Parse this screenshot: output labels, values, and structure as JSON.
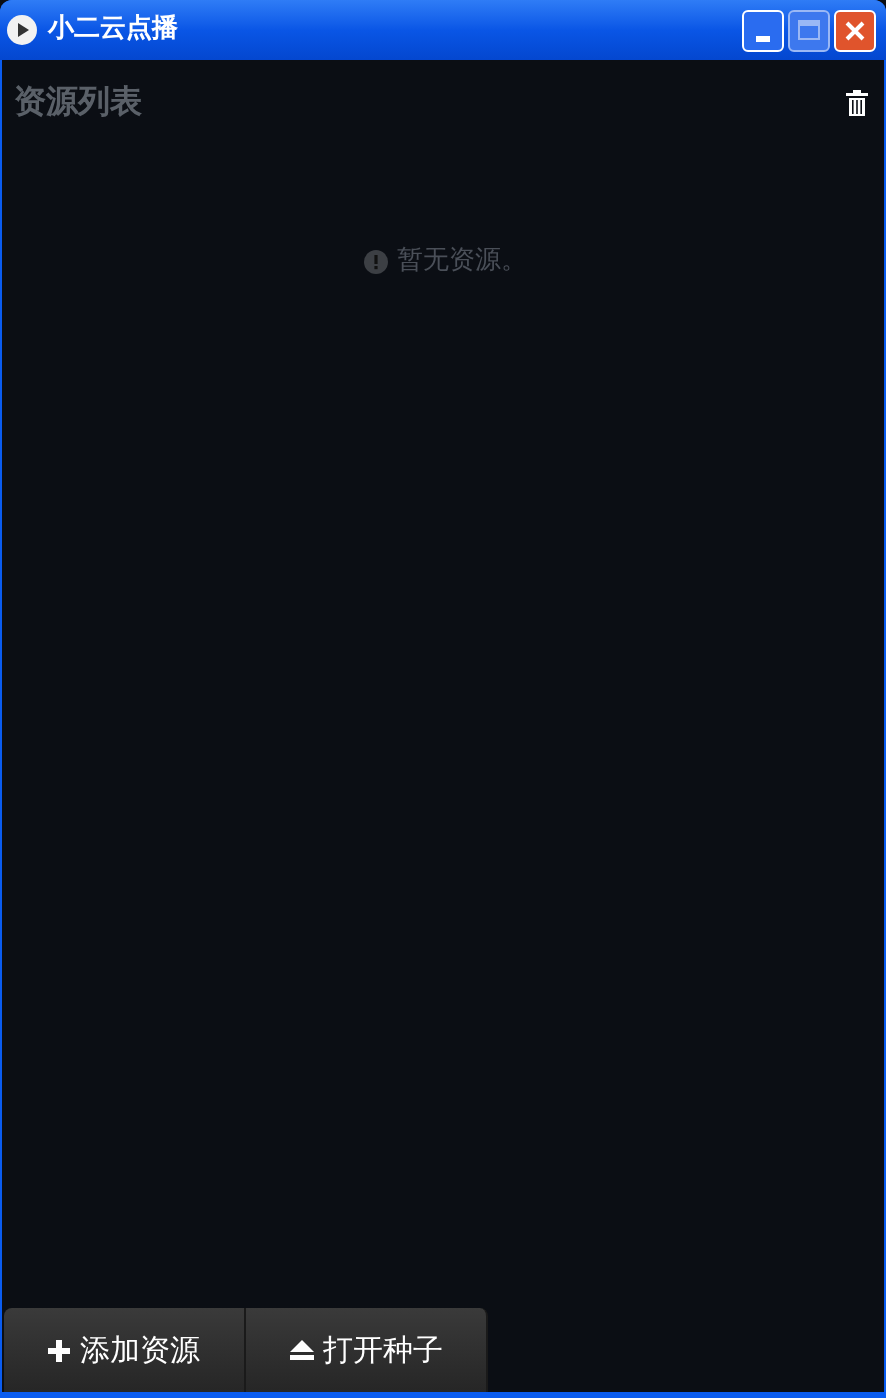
{
  "window": {
    "title": "小二云点播"
  },
  "panel": {
    "title": "资源列表",
    "empty_message": "暂无资源。"
  },
  "buttons": [
    {
      "kind": "add",
      "label": "添加资源"
    },
    {
      "kind": "eject",
      "label": "打开种子"
    }
  ]
}
